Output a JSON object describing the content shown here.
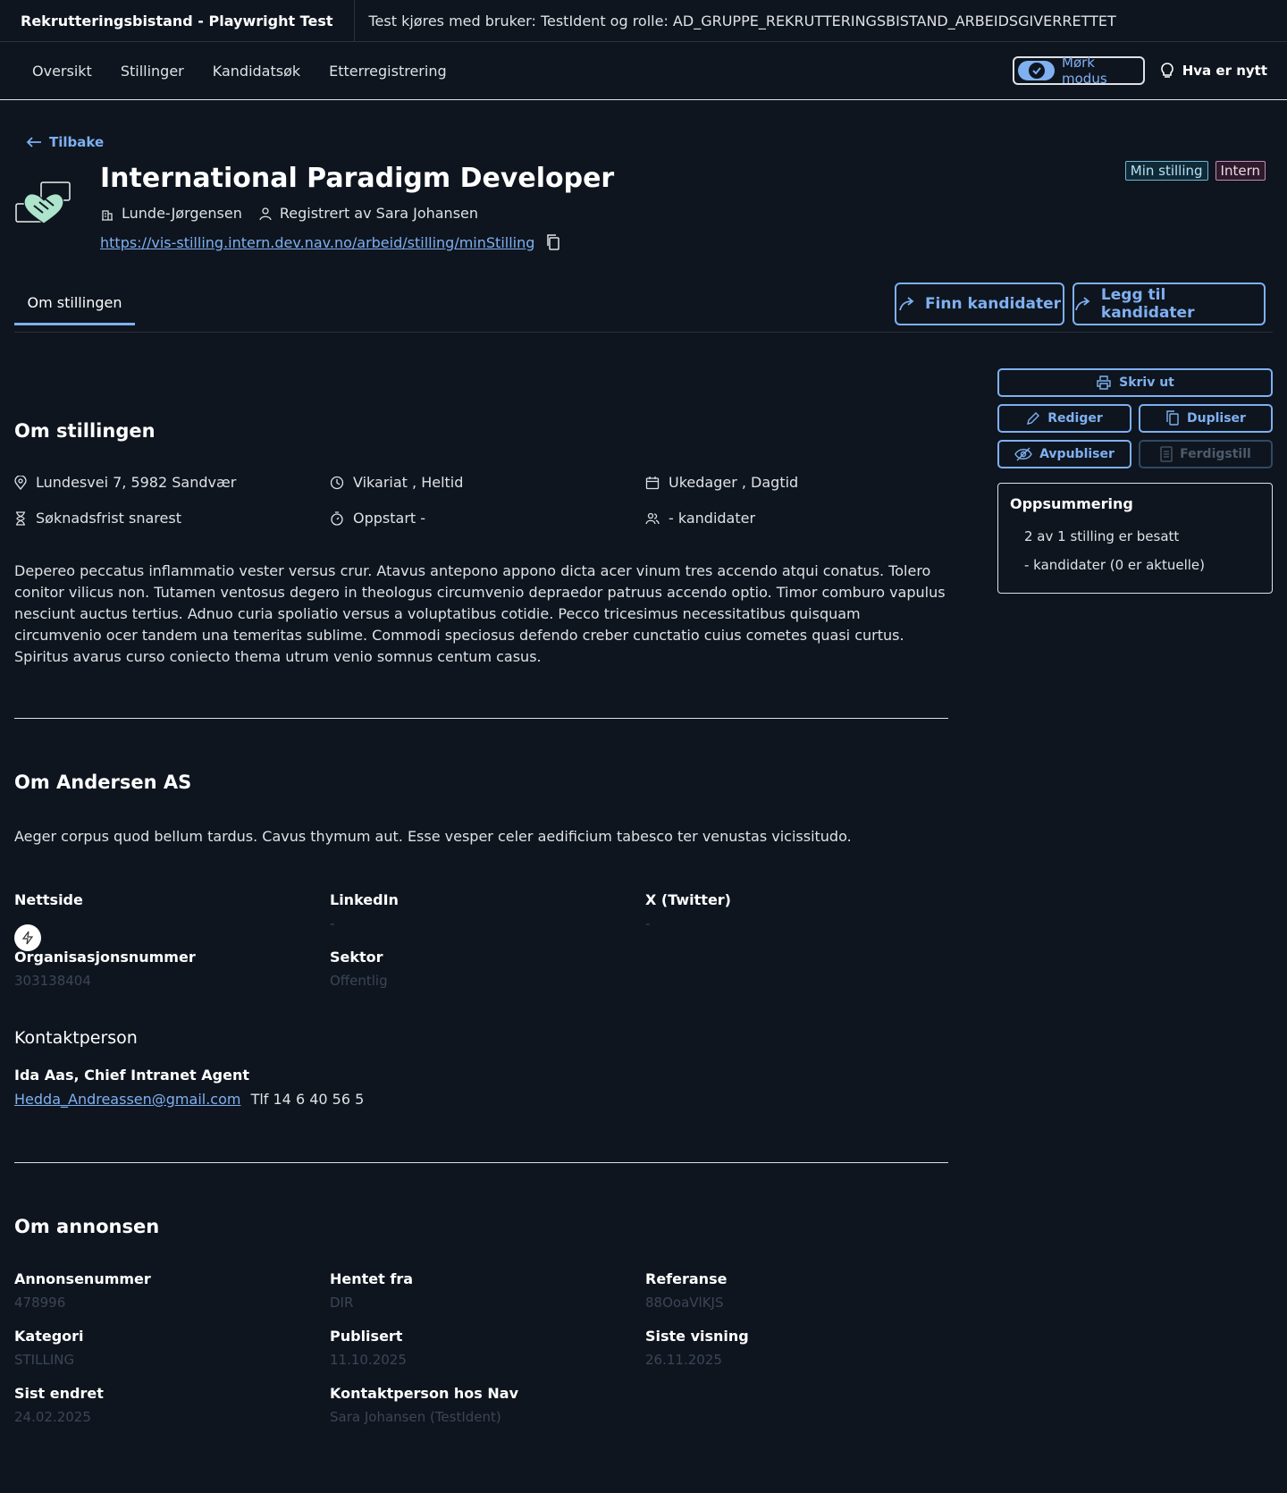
{
  "topbar": {
    "app_title": "Rekrutteringsbistand - Playwright Test",
    "user_info": "Test kjøres med bruker: TestIdent og rolle: AD_GRUPPE_REKRUTTERINGSBISTAND_ARBEIDSGIVERRETTET"
  },
  "nav": {
    "items": [
      "Oversikt",
      "Stillinger",
      "Kandidatsøk",
      "Etterregistrering"
    ],
    "dark_mode_label": "Mørk modus",
    "whats_new_label": "Hva er nytt"
  },
  "header": {
    "back_label": "Tilbake",
    "title": "International Paradigm Developer",
    "employer": "Lunde-Jørgensen",
    "registered_by": "Registrert av Sara Johansen",
    "url": "https://vis-stilling.intern.dev.nav.no/arbeid/stilling/minStilling",
    "tags": [
      "Min stilling",
      "Intern"
    ]
  },
  "tabs": {
    "active": "Om stillingen"
  },
  "actions": {
    "find_candidates": "Finn kandidater",
    "add_candidates": "Legg til kandidater"
  },
  "sidebar": {
    "print": "Skriv ut",
    "edit": "Rediger",
    "duplicate": "Dupliser",
    "unpublish": "Avpubliser",
    "complete": "Ferdigstill",
    "summary_title": "Oppsummering",
    "summary_items": [
      "2 av 1 stilling er besatt",
      "- kandidater (0 er aktuelle)"
    ]
  },
  "about_position": {
    "heading": "Om stillingen",
    "address": "Lundesvei 7, 5982 Sandvær",
    "employment": "Vikariat , Heltid",
    "workdays": "Ukedager , Dagtid",
    "deadline": "Søknadsfrist snarest",
    "start": "Oppstart -",
    "candidates": "- kandidater",
    "description": "Depereo peccatus inflammatio vester versus crur. Atavus antepono appono dicta acer vinum tres accendo atqui conatus. Tolero conitor vilicus non. Tutamen ventosus degero in theologus circumvenio depraedor patruus accendo optio. Timor comburo vapulus nesciunt auctus tertius. Adnuo curia spoliatio versus a voluptatibus cotidie. Pecco tricesimus necessitatibus quisquam circumvenio ocer tandem una temeritas sublime. Commodi speciosus defendo creber cunctatio cuius cometes quasi curtus. Spiritus avarus curso coniecto thema utrum venio somnus centum casus."
  },
  "about_company": {
    "heading": "Om Andersen AS",
    "description": "Aeger corpus quod bellum tardus. Cavus thymum aut. Esse vesper celer aedificium tabesco ter venustas vicissitudo.",
    "website_label": "Nettside",
    "website_value": "",
    "linkedin_label": "LinkedIn",
    "linkedin_value": "-",
    "twitter_label": "X (Twitter)",
    "twitter_value": "-",
    "orgnr_label": "Organisasjonsnummer",
    "orgnr_value": "303138404",
    "sector_label": "Sektor",
    "sector_value": "Offentlig",
    "contact_heading": "Kontaktperson",
    "contact_name": "Ida Aas, Chief Intranet Agent",
    "contact_email": "Hedda_Andreassen@gmail.com",
    "contact_phone": "Tlf 14 6 40 56 5"
  },
  "about_ad": {
    "heading": "Om annonsen",
    "fields": [
      {
        "label": "Annonsenummer",
        "value": "478996"
      },
      {
        "label": "Hentet fra",
        "value": "DIR"
      },
      {
        "label": "Referanse",
        "value": "88OoaVlKJS"
      },
      {
        "label": "Kategori",
        "value": "STILLING"
      },
      {
        "label": "Publisert",
        "value": "11.10.2025"
      },
      {
        "label": "Siste visning",
        "value": "26.11.2025"
      },
      {
        "label": "Sist endret",
        "value": "24.02.2025"
      },
      {
        "label": "Kontaktperson hos Nav",
        "value": "Sara Johansen (TestIdent)"
      }
    ]
  },
  "colors": {
    "accent": "#7fb0f0",
    "background": "#0e151f",
    "text": "#dfe1e5"
  }
}
